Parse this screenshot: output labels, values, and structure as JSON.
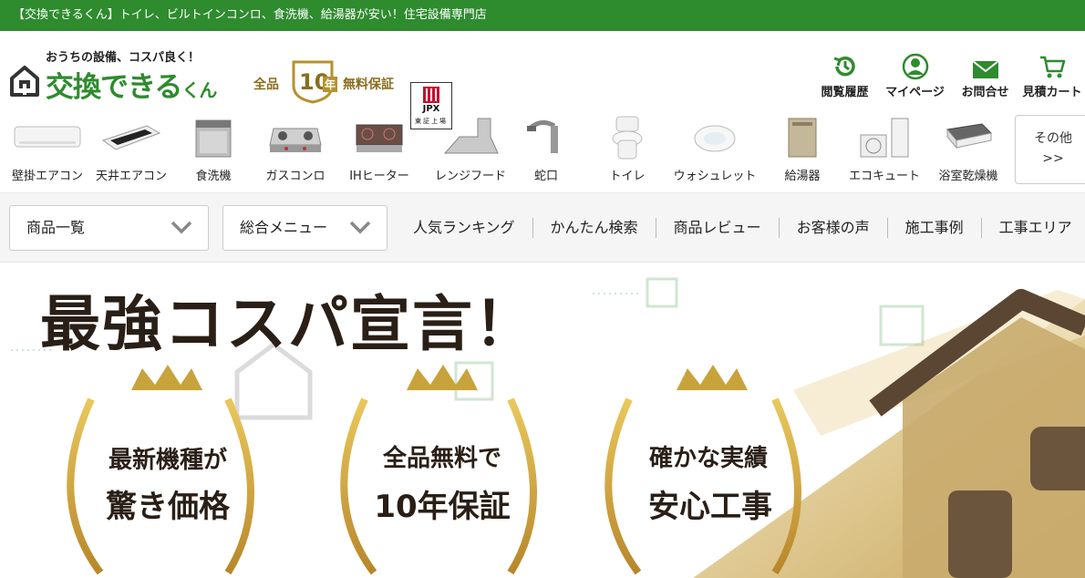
{
  "topbar": {
    "text": "【交換できるくん】トイレ、ビルトインコンロ、食洗機、給湯器が安い！住宅設備専門店"
  },
  "logo": {
    "tagline": "おうちの設備、コスパ良く！",
    "name_main": "交換できる",
    "name_small": "くん"
  },
  "warranty": {
    "left": "全品",
    "number": "10",
    "year": "年",
    "right": "無料保証"
  },
  "jpx": {
    "label": "JPX",
    "sub": "東証上場"
  },
  "header_nav": [
    {
      "label": "閲覧履歴",
      "icon": "history-icon"
    },
    {
      "label": "マイページ",
      "icon": "user-icon"
    },
    {
      "label": "お問合せ",
      "icon": "mail-icon"
    },
    {
      "label": "見積カート",
      "icon": "cart-icon"
    }
  ],
  "categories": [
    {
      "label": "壁掛エアコン"
    },
    {
      "label": "天井エアコン"
    },
    {
      "label": "食洗機"
    },
    {
      "label": "ガスコンロ"
    },
    {
      "label": "IHヒーター"
    },
    {
      "label": "レンジフード"
    },
    {
      "label": "蛇口"
    },
    {
      "label": "トイレ"
    },
    {
      "label": "ウォシュレット"
    },
    {
      "label": "給湯器"
    },
    {
      "label": "エコキュート"
    },
    {
      "label": "浴室乾燥機"
    }
  ],
  "categories_more": {
    "line1": "その他",
    "line2": ">>"
  },
  "menu": {
    "dropdown1": "商品一覧",
    "dropdown2": "総合メニュー",
    "links": [
      "人気ランキング",
      "かんたん検索",
      "商品レビュー",
      "お客様の声",
      "施工事例",
      "工事エリア"
    ]
  },
  "hero": {
    "headline": "最強コスパ宣言！",
    "awards": [
      {
        "line1": "最新機種が",
        "line2": "驚き価格"
      },
      {
        "line1": "全品無料で",
        "line2": "10年保証"
      },
      {
        "line1": "確かな実績",
        "line2": "安心工事"
      }
    ]
  },
  "colors": {
    "brand_green": "#2e8b2e",
    "gold": "#b8912e",
    "dark_text": "#2a1f16"
  }
}
